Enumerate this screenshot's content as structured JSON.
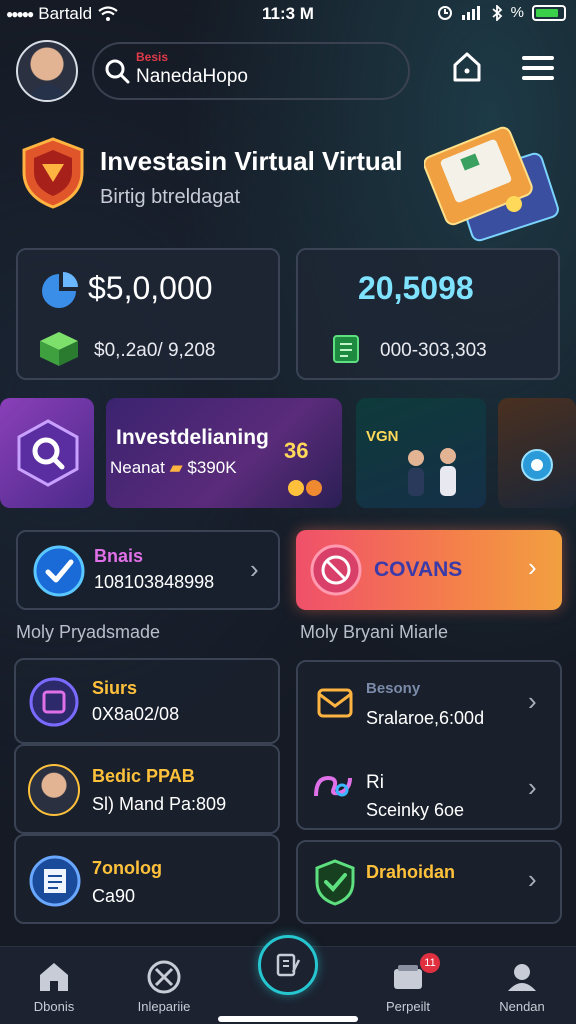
{
  "status_bar": {
    "carrier": "Bartald",
    "time": "11:3 M",
    "icons": [
      "wifi-icon",
      "signal-icon",
      "bluetooth-icon",
      "battery-icon"
    ],
    "extra": "%"
  },
  "header": {
    "search_small": "Besis",
    "search_value": "NanedaHopo",
    "icons": [
      "search-icon",
      "home-icon",
      "menu-icon"
    ]
  },
  "hero": {
    "title": "Investasin Virtual Virtual",
    "subtitle": "Birtig btreldagat"
  },
  "stats": {
    "left": {
      "big": "$5,0,000",
      "small": "$0,.2a0/ 9,208"
    },
    "right": {
      "big": "20,5098",
      "small": "000-303,303"
    }
  },
  "banners": {
    "main_title": "Investdelianing",
    "main_sub": "Neanat",
    "main_amount": "$390K",
    "main_num": "36",
    "promo_label": "VGN"
  },
  "actions": {
    "left_title": "Bnais",
    "left_value": "108103848998",
    "right_label": "COVANS"
  },
  "sections": {
    "left": "Moly Pryadsmade",
    "right": "Moly Bryani Miarle"
  },
  "list_left": [
    {
      "title": "Siurs",
      "sub": "0X8a02/08"
    },
    {
      "title": "Bedic PPAB",
      "sub": "Sl) Mand Pa:809"
    },
    {
      "title": "7onolog",
      "sub": "Ca90"
    }
  ],
  "list_right": [
    {
      "title": "Besony",
      "sub": "Sralaroe,6:00d"
    },
    {
      "title": "Ri",
      "sub": "Sceinky 6oe"
    },
    {
      "title": "Drahoidan",
      "sub": ""
    }
  ],
  "bottom_nav": {
    "items": [
      "Dbonis",
      "Inlepariie",
      "",
      "Perpeilt",
      "Nendan"
    ],
    "badge": "11"
  },
  "colors": {
    "accent_orange": "#f4804a",
    "accent_cyan": "#26c6d0",
    "gold": "#ffc13b"
  }
}
